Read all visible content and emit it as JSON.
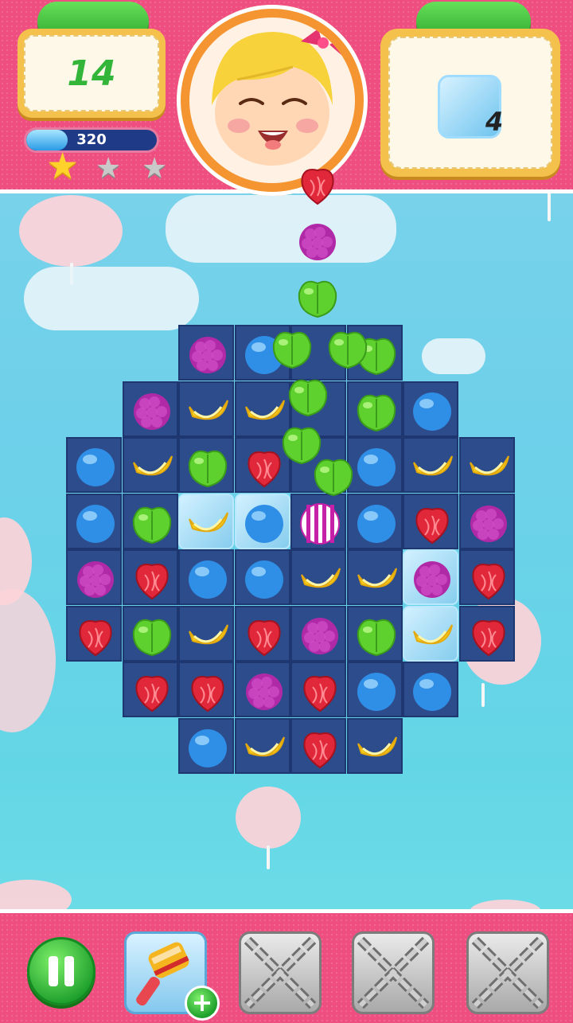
{
  "hud": {
    "moves_left": "14",
    "score": "320",
    "score_progress": 0.32,
    "stars_earned": 1,
    "stars_total": 3,
    "goal": {
      "item": "ice-block",
      "count": "4"
    }
  },
  "board": {
    "rows": [
      [
        "",
        "",
        "grape",
        "blueberry",
        "",
        "apple",
        "",
        ""
      ],
      [
        "",
        "grape",
        "banana",
        "banana",
        "",
        "apple",
        "blueberry",
        ""
      ],
      [
        "blueberry",
        "banana",
        "apple",
        "strawberry",
        "",
        "blueberry",
        "banana",
        "banana"
      ],
      [
        "blueberry",
        "apple",
        "banana",
        "blueberry",
        "striped-candy",
        "blueberry",
        "strawberry",
        "grape"
      ],
      [
        "grape",
        "strawberry",
        "blueberry",
        "blueberry",
        "banana",
        "banana",
        "grape",
        "strawberry"
      ],
      [
        "strawberry",
        "apple",
        "banana",
        "strawberry",
        "grape",
        "apple",
        "banana",
        "strawberry"
      ],
      [
        "",
        "strawberry",
        "strawberry",
        "grape",
        "strawberry",
        "blueberry",
        "blueberry",
        ""
      ],
      [
        "",
        "",
        "blueberry",
        "banana",
        "strawberry",
        "banana",
        "",
        ""
      ]
    ],
    "frozen_cells": [
      [
        3,
        2
      ],
      [
        3,
        3
      ],
      [
        4,
        6
      ],
      [
        5,
        6
      ]
    ],
    "falling": [
      "strawberry",
      "grape",
      "apple",
      "apple",
      "apple",
      "apple",
      "apple",
      "apple"
    ]
  },
  "colors": {
    "strawberry": "#e0283a",
    "grape": "#b02aa8",
    "blueberry": "#2f8fe6",
    "banana": "#f7cf1c",
    "apple": "#5fd12e"
  },
  "boosters": [
    {
      "icon": "hammer-icon",
      "state": "available"
    },
    {
      "icon": "chain-lock-icon",
      "state": "locked"
    },
    {
      "icon": "chain-lock-icon",
      "state": "locked"
    },
    {
      "icon": "chain-lock-icon",
      "state": "locked"
    }
  ]
}
